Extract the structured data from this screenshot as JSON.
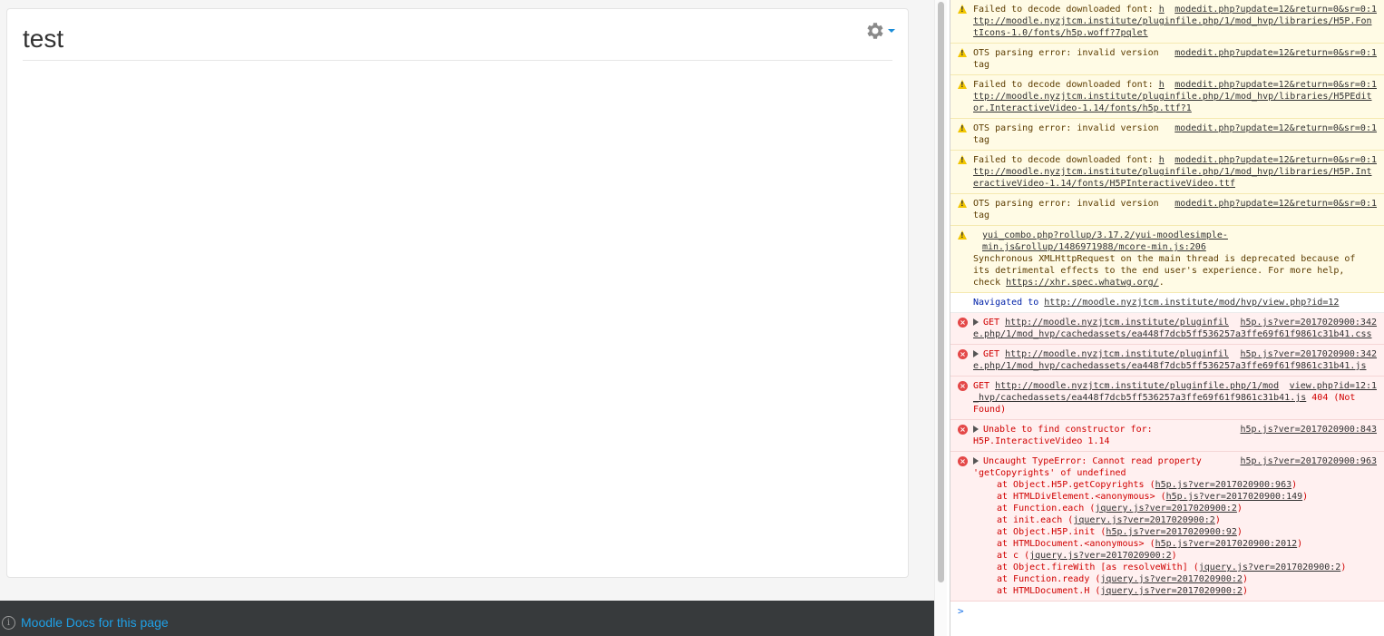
{
  "page": {
    "title": "test",
    "footer_link": "Moodle Docs for this page"
  },
  "console": {
    "prompt": ">",
    "messages": [
      {
        "level": "warning",
        "source": "modedit.php?update=12&return=0&sr=0:1",
        "text": "Failed to decode downloaded font: ",
        "link": "http://moodle.nyzjtcm.institute/pluginfile.php/1/mod_hvp/libraries/H5P.FontIcons-1.0/fonts/h5p.woff?7pqlet"
      },
      {
        "level": "warning",
        "source": "modedit.php?update=12&return=0&sr=0:1",
        "text": "OTS parsing error: invalid version tag",
        "link": ""
      },
      {
        "level": "warning",
        "source": "modedit.php?update=12&return=0&sr=0:1",
        "text": "Failed to decode downloaded font: ",
        "link": "http://moodle.nyzjtcm.institute/pluginfile.php/1/mod_hvp/libraries/H5PEditor.InteractiveVideo-1.14/fonts/h5p.ttf?1"
      },
      {
        "level": "warning",
        "source": "modedit.php?update=12&return=0&sr=0:1",
        "text": "OTS parsing error: invalid version tag",
        "link": ""
      },
      {
        "level": "warning",
        "source": "modedit.php?update=12&return=0&sr=0:1",
        "text": "Failed to decode downloaded font: ",
        "link": "http://moodle.nyzjtcm.institute/pluginfile.php/1/mod_hvp/libraries/H5P.InteractiveVideo-1.14/fonts/H5PInteractiveVideo.ttf"
      },
      {
        "level": "warning",
        "source": "modedit.php?update=12&return=0&sr=0:1",
        "text": "OTS parsing error: invalid version tag",
        "link": ""
      },
      {
        "level": "warning",
        "source": "yui_combo.php?rollup/3.17.2/yui-moodlesimple-min.js&rollup/1486971988/mcore-min.js:206",
        "text": "Synchronous XMLHttpRequest on the main thread is deprecated because of its detrimental effects to the end user's experience. For more help, check ",
        "link": "https://xhr.spec.whatwg.org/",
        "suffix": "."
      },
      {
        "level": "info",
        "source": "",
        "text": "Navigated to ",
        "link": "http://moodle.nyzjtcm.institute/mod/hvp/view.php?id=12"
      },
      {
        "level": "error",
        "source": "h5p.js?ver=2017020900:342",
        "text": "GET ",
        "link": "http://moodle.nyzjtcm.institute/pluginfile.php/1/mod_hvp/cachedassets/ea448f7dcb5ff536257a3ffe69f61f9861c31b41.css",
        "expand": true
      },
      {
        "level": "error",
        "source": "h5p.js?ver=2017020900:342",
        "text": "GET ",
        "link": "http://moodle.nyzjtcm.institute/pluginfile.php/1/mod_hvp/cachedassets/ea448f7dcb5ff536257a3ffe69f61f9861c31b41.js",
        "expand": true
      },
      {
        "level": "error",
        "source": "view.php?id=12:1",
        "text": "GET ",
        "link": "http://moodle.nyzjtcm.institute/pluginfile.php/1/mod_hvp/cachedassets/ea448f7dcb5ff536257a3ffe69f61f9861c31b41.js",
        "suffix": " 404 (Not Found)"
      },
      {
        "level": "error",
        "source": "h5p.js?ver=2017020900:843",
        "text": "Unable to find constructor for: H5P.InteractiveVideo 1.14",
        "link": "",
        "expand": true
      },
      {
        "level": "error",
        "source": "h5p.js?ver=2017020900:963",
        "text": "Uncaught TypeError: Cannot read property 'getCopyrights' of undefined",
        "link": "",
        "expand": true,
        "stack": [
          {
            "at": "at Object.H5P.getCopyrights (",
            "ref": "h5p.js?ver=2017020900:963"
          },
          {
            "at": "at HTMLDivElement.<anonymous> (",
            "ref": "h5p.js?ver=2017020900:149"
          },
          {
            "at": "at Function.each (",
            "ref": "jquery.js?ver=2017020900:2"
          },
          {
            "at": "at init.each (",
            "ref": "jquery.js?ver=2017020900:2"
          },
          {
            "at": "at Object.H5P.init (",
            "ref": "h5p.js?ver=2017020900:92"
          },
          {
            "at": "at HTMLDocument.<anonymous> (",
            "ref": "h5p.js?ver=2017020900:2012"
          },
          {
            "at": "at c (",
            "ref": "jquery.js?ver=2017020900:2"
          },
          {
            "at": "at Object.fireWith [as resolveWith] (",
            "ref": "jquery.js?ver=2017020900:2"
          },
          {
            "at": "at Function.ready (",
            "ref": "jquery.js?ver=2017020900:2"
          },
          {
            "at": "at HTMLDocument.H (",
            "ref": "jquery.js?ver=2017020900:2"
          }
        ]
      }
    ]
  },
  "colors": {
    "link_blue": "#1fa0e6",
    "footer_bg": "#373a3c",
    "warning_bg": "#fffbe5",
    "error_bg": "#fff0f0",
    "error_text": "#d00000"
  }
}
